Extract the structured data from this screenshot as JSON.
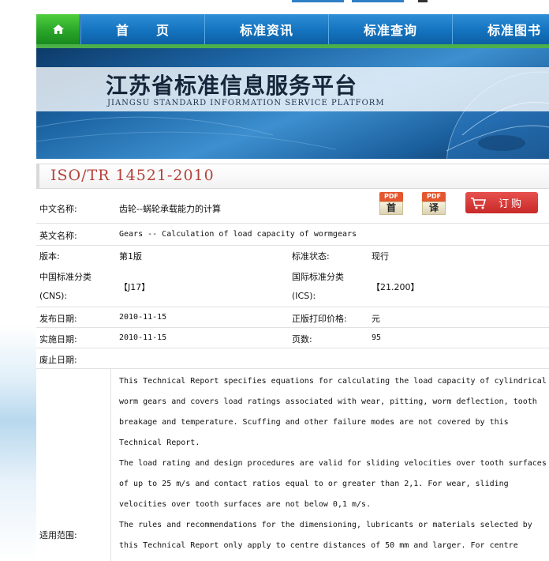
{
  "nav": {
    "home_icon": "home-icon",
    "items": [
      "首　　页",
      "标准资讯",
      "标准查询",
      "标准图书"
    ]
  },
  "banner": {
    "title": "江苏省标准信息服务平台",
    "subtitle": "JIANGSU STANDARD INFORMATION SERVICE PLATFORM"
  },
  "standard": {
    "code": "ISO/TR 14521-2010",
    "cn_name_label": "中文名称:",
    "cn_name": "齿轮--蜗轮承载能力的计算",
    "en_name_label": "英文名称:",
    "en_name": "Gears -- Calculation of load capacity of wormgears",
    "version_label": "版本:",
    "version": "第1版",
    "status_label": "标准状态:",
    "status": "现行",
    "cns_label_1": "中国标准分类",
    "cns_label_2": "(CNS):",
    "cns_value": "【J17】",
    "ics_label_1": "国际标准分类",
    "ics_label_2": "(ICS):",
    "ics_value": "【21.200】",
    "publish_label": "发布日期:",
    "publish_date": "2010-11-15",
    "price_label": "正版打印价格:",
    "price": "元",
    "implement_label": "实施日期:",
    "implement_date": "2010-11-15",
    "pages_label": "页数:",
    "pages": "95",
    "abolish_label": "废止日期:",
    "scope_label": "适用范围:",
    "scope_paragraphs": [
      "This Technical Report specifies equations for calculating the load capacity of cylindrical worm gears and covers load ratings associated with wear, pitting, worm deflection, tooth breakage and temperature. Scuffing and other failure modes are not covered by this Technical Report.",
      "The load rating and design procedures are valid for sliding velocities over tooth surfaces of up to 25 m/s and contact ratios equal to or greater than 2,1. For wear, sliding velocities over tooth surfaces are not below 0,1 m/s.",
      "The rules and recommendations for the dimensioning, lubricants or materials selected by this Technical Report only apply to centre distances of 50 mm and larger. For centre"
    ]
  },
  "actions": {
    "pdf_label": "PDF",
    "pdf_first": "首",
    "pdf_translate": "译",
    "buy_label": "订购",
    "cart_icon": "cart-icon"
  },
  "colors": {
    "nav_blue": "#1b6fb0",
    "home_green": "#2aa62a",
    "code_red": "#b5413a",
    "buy_red": "#d43a37"
  }
}
